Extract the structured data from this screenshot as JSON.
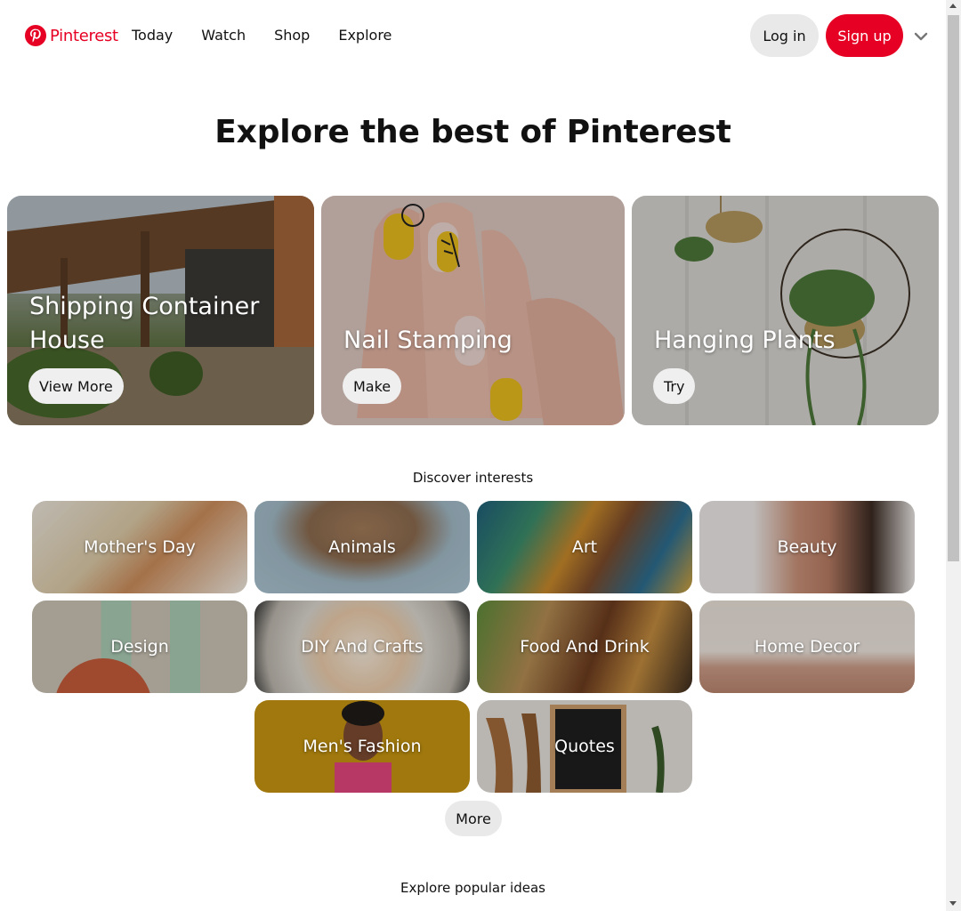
{
  "header": {
    "logo_text": "Pinterest",
    "nav": [
      "Today",
      "Watch",
      "Shop",
      "Explore"
    ],
    "login_label": "Log in",
    "signup_label": "Sign up",
    "brand_color": "#e60023"
  },
  "hero": {
    "title": "Explore the best of Pinterest",
    "features": [
      {
        "title_lines": [
          "Shipping Container",
          "House"
        ],
        "button": "View More"
      },
      {
        "title_lines": [
          "Nail Stamping"
        ],
        "button": "Make"
      },
      {
        "title_lines": [
          "Hanging Plants"
        ],
        "button": "Try"
      }
    ]
  },
  "discover": {
    "heading": "Discover interests",
    "tiles": [
      "Mother's Day",
      "Animals",
      "Art",
      "Beauty",
      "Design",
      "DIY And Crafts",
      "Food And Drink",
      "Home Decor",
      "Men's Fashion",
      "Quotes"
    ],
    "more_label": "More"
  },
  "popular": {
    "heading": "Explore popular ideas"
  }
}
